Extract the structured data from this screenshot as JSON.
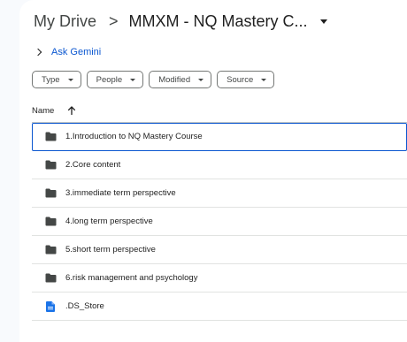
{
  "breadcrumb": {
    "root": "My Drive",
    "separator": ">",
    "current": "MMXM - NQ Mastery C..."
  },
  "gemini": {
    "label": "Ask Gemini"
  },
  "filters": [
    {
      "label": "Type"
    },
    {
      "label": "People"
    },
    {
      "label": "Modified"
    },
    {
      "label": "Source"
    }
  ],
  "columns": {
    "name": "Name",
    "sort": "ascending"
  },
  "files": [
    {
      "name": "1.Introduction to NQ Mastery Course",
      "kind": "folder",
      "icon": "folder-icon"
    },
    {
      "name": "2.Core content",
      "kind": "folder",
      "icon": "folder-icon"
    },
    {
      "name": "3.immediate term perspective",
      "kind": "folder",
      "icon": "folder-icon"
    },
    {
      "name": "4.long term perspective",
      "kind": "folder",
      "icon": "folder-icon"
    },
    {
      "name": "5.short term perspective",
      "kind": "folder",
      "icon": "folder-icon"
    },
    {
      "name": "6.risk management and psychology",
      "kind": "folder",
      "icon": "folder-icon"
    },
    {
      "name": ".DS_Store",
      "kind": "file",
      "icon": "file-icon"
    }
  ],
  "colors": {
    "accent": "#0b57d0",
    "folder": "#444746",
    "file": "#1a73e8"
  }
}
